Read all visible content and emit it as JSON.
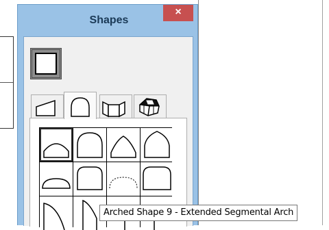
{
  "window": {
    "title": "Shapes",
    "close_glyph": "×"
  },
  "tabs": [
    {
      "icon": "trapezoid-shape-icon"
    },
    {
      "icon": "arch-shape-icon",
      "selected": true
    },
    {
      "icon": "bay-window-shape-icon"
    },
    {
      "icon": "3d-shape-icon"
    }
  ],
  "shape_grid": {
    "selected_index": 0,
    "items": [
      "segmental-arch-icon",
      "round-top-arch-icon",
      "gothic-arch-icon",
      "pointed-arch-icon",
      "half-round-arch-icon",
      "tall-round-arch-icon",
      "dashed-segmental-arch-icon",
      "eyebrow-arch-icon",
      "quarter-round-arch-icon",
      "half-arch-icon",
      "partial-arch-icon",
      "partial-arch-2-icon"
    ]
  },
  "tooltip": {
    "text": "Arched Shape 9 - Extended Segmental Arch"
  },
  "colors": {
    "frame": "#9ac2e6",
    "close": "#c75050",
    "client": "#f0f0f0"
  }
}
